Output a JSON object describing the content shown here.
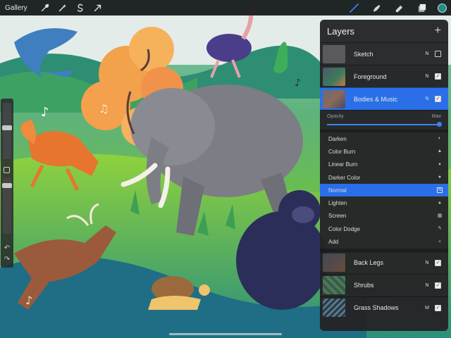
{
  "topbar": {
    "gallery_label": "Gallery",
    "left_tools": [
      "wrench-icon",
      "magic-wand-icon",
      "selection-icon",
      "transform-arrow-icon"
    ],
    "right_tools": [
      "brush-icon",
      "smudge-icon",
      "eraser-icon",
      "layers-icon"
    ],
    "current_color": "#1f8f86",
    "accent": "#3b82f6"
  },
  "layers_panel": {
    "title": "Layers",
    "add_label": "+",
    "top_layers": [
      {
        "name": "Sketch",
        "mode": "N",
        "visible": false,
        "active": false
      },
      {
        "name": "Foreground",
        "mode": "N",
        "visible": true,
        "active": false
      },
      {
        "name": "Bodies & Music",
        "mode": "N",
        "visible": true,
        "active": true
      }
    ],
    "opacity": {
      "label": "Opacity",
      "max_label": "Max",
      "value": 1.0
    },
    "blend_modes": [
      {
        "name": "Darken",
        "icon": "◐",
        "active": false
      },
      {
        "name": "Color Burn",
        "icon": "▲",
        "active": false
      },
      {
        "name": "Linear Burn",
        "icon": "♦",
        "active": false
      },
      {
        "name": "Darker Color",
        "icon": "●",
        "active": false
      },
      {
        "name": "Normal",
        "icon": "N",
        "active": true
      },
      {
        "name": "Lighten",
        "icon": "●",
        "active": false
      },
      {
        "name": "Screen",
        "icon": "▦",
        "active": false
      },
      {
        "name": "Color Dodge",
        "icon": "✎",
        "active": false
      },
      {
        "name": "Add",
        "icon": "+",
        "active": false
      }
    ],
    "bottom_layers": [
      {
        "name": "Back Legs",
        "mode": "N",
        "visible": true
      },
      {
        "name": "Shrubs",
        "mode": "N",
        "visible": true
      },
      {
        "name": "Grass Shadows",
        "mode": "M",
        "visible": true
      }
    ]
  }
}
